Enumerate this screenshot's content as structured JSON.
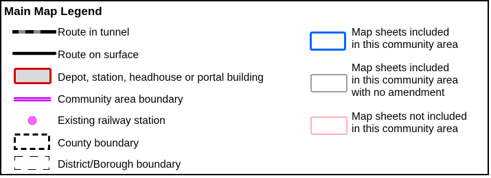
{
  "legend": {
    "title": "Main Map Legend",
    "items": [
      {
        "label": "Route in tunnel",
        "icon": "tunnel-route-icon"
      },
      {
        "label": "Route on surface",
        "icon": "surface-route-icon"
      },
      {
        "label": "Depot, station, headhouse or portal building",
        "icon": "building-icon",
        "stroke": "#d40000",
        "fill": "#d9d9d9"
      },
      {
        "label": "Community area boundary",
        "icon": "community-boundary-icon",
        "color": "#cc00ff"
      },
      {
        "label": "Existing railway station",
        "icon": "railway-station-icon",
        "color": "#ff66ff"
      },
      {
        "label": "County boundary",
        "icon": "county-boundary-icon"
      },
      {
        "label": "District/Borough boundary",
        "icon": "district-boundary-icon"
      }
    ],
    "map_sheets": [
      {
        "lines": [
          "Map sheets included",
          "in this community area"
        ],
        "icon": "sheet-included-icon",
        "color": "#0066ff"
      },
      {
        "lines": [
          "Map sheets included",
          "in this community area",
          "with no amendment"
        ],
        "icon": "sheet-no-amendment-icon",
        "color": "#808080"
      },
      {
        "lines": [
          "Map sheets not included",
          "in this community area"
        ],
        "icon": "sheet-not-included-icon",
        "color": "#ff9999"
      }
    ]
  }
}
